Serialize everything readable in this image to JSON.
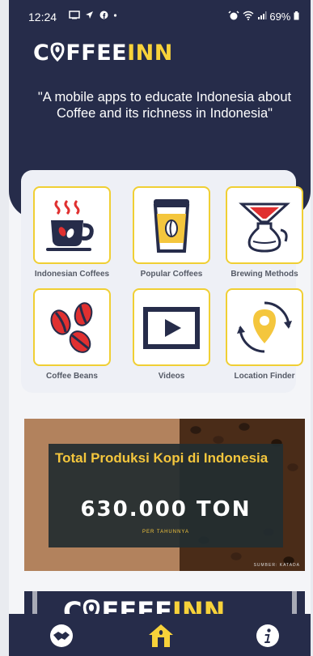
{
  "status_bar": {
    "time": "12:24",
    "left_icons": [
      "cast-icon",
      "navigation-icon",
      "facebook-icon",
      "dot-icon"
    ],
    "battery": "69%"
  },
  "header": {
    "logo_part1": "C",
    "logo_part1b": "FFEE",
    "logo_part2": "INN",
    "tagline": "\"A mobile apps to educate Indonesia about Coffee and its richness in Indonesia\""
  },
  "menu": {
    "items": [
      {
        "label": "Indonesian Coffees",
        "icon": "coffee-cup-icon"
      },
      {
        "label": "Popular Coffees",
        "icon": "takeaway-cup-icon"
      },
      {
        "label": "Brewing Methods",
        "icon": "pour-over-icon"
      },
      {
        "label": "Coffee Beans",
        "icon": "coffee-beans-icon"
      },
      {
        "label": "Videos",
        "icon": "video-play-icon"
      },
      {
        "label": "Location Finder",
        "icon": "location-pin-icon"
      }
    ]
  },
  "banner": {
    "title": "Total Produksi Kopi di Indonesia",
    "value": "630.000 TON",
    "subtitle": "PER TAHUNNYA",
    "source": "SUMBER: KATADA"
  },
  "banner2": {
    "logo_part1": "C",
    "logo_part1b": "FFEE",
    "logo_part2": "INN"
  },
  "nav": {
    "items": [
      "handshake-icon",
      "home-icon",
      "info-icon"
    ]
  },
  "colors": {
    "primary": "#262c4a",
    "accent": "#f7d23a",
    "tile_border": "#f0cf34"
  }
}
